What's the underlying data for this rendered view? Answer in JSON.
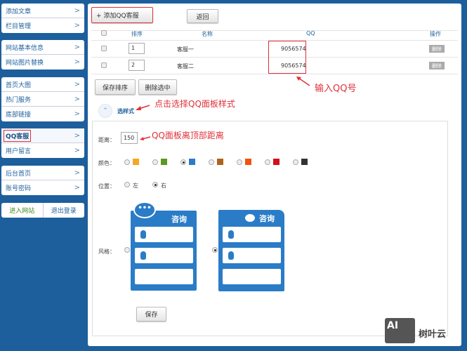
{
  "sidebar": {
    "groups": [
      [
        "添加文章",
        "栏目管理"
      ],
      [
        "网站基本信息",
        "网站图片替换"
      ],
      [
        "首页大图",
        "热门服务",
        "底部链接"
      ],
      [
        "QQ客服",
        "用户留言"
      ],
      [
        "后台首页",
        "账号密码"
      ]
    ],
    "enter_site": "进入网站",
    "logout": "退出登录",
    "chevron": ">"
  },
  "toolbar": {
    "add": "+ 添加QQ客服",
    "back": "返回"
  },
  "table": {
    "headers": [
      "排序",
      "名称",
      "QQ",
      "操作"
    ],
    "rows": [
      {
        "order": "1",
        "name": "客服一",
        "qq": "9056574",
        "action": "删除"
      },
      {
        "order": "2",
        "name": "客服二",
        "qq": "9056574",
        "action": "删除"
      }
    ]
  },
  "actions": {
    "save_order": "保存排序",
    "delete_selected": "删除选中"
  },
  "style_toggle": {
    "label": "选样式",
    "icon": "chevron-up-icon"
  },
  "annotations": {
    "qq": "输入QQ号",
    "style": "点击选择QQ面板样式",
    "distance": "QQ面板离顶部距离"
  },
  "form": {
    "distance_label": "距离：",
    "distance_value": "150",
    "color_label": "颜色：",
    "colors": [
      "#f5a623",
      "#5a9a1e",
      "#2a7cc7",
      "#b0621c",
      "#f0540f",
      "#d0101a",
      "#333333"
    ],
    "selected_color": 2,
    "position_label": "位置：",
    "positions": [
      "左",
      "右"
    ],
    "selected_position": 1,
    "style_label": "风格：",
    "panel_title": "咨询",
    "selected_style": 1,
    "save": "保存"
  },
  "watermark": {
    "logo": "AI",
    "text": "树叶云"
  }
}
